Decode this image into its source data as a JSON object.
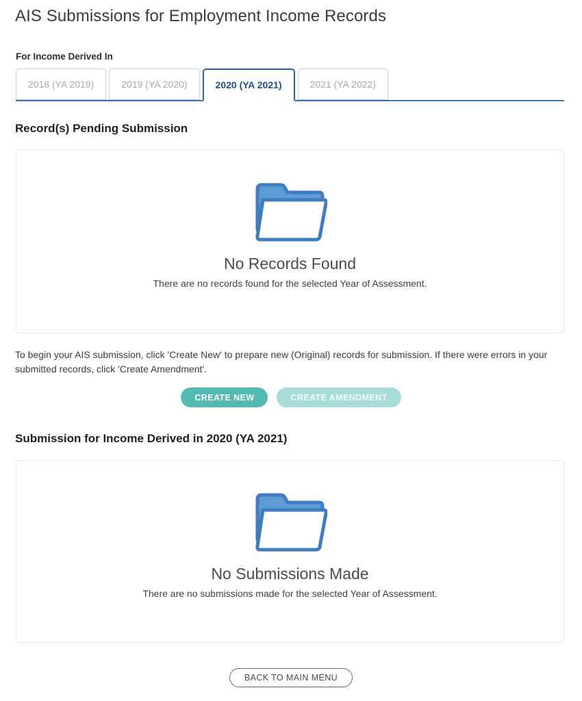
{
  "page": {
    "title": "AIS Submissions for Employment Income Records"
  },
  "tabs": {
    "label": "For Income Derived In",
    "items": [
      {
        "label": "2018 (YA 2019)",
        "active": false
      },
      {
        "label": "2019 (YA 2020)",
        "active": false
      },
      {
        "label": "2020 (YA 2021)",
        "active": true
      },
      {
        "label": "2021 (YA 2022)",
        "active": false
      }
    ],
    "active_index": 2,
    "active_color": "#2b5f9e",
    "inactive_color": "#a8a8a8",
    "underline_color": "#3573b9"
  },
  "pending_section": {
    "heading": "Record(s) Pending Submission",
    "empty_state": {
      "icon": "folder-open-icon",
      "title": "No Records Found",
      "subtitle": "There are no records found for the selected Year of Assessment."
    }
  },
  "instructions": {
    "text": "To begin your AIS submission, click 'Create New' to prepare new (Original) records for submission. If there were errors in your submitted records, click 'Create Amendment'."
  },
  "actions": {
    "create_new_label": "CREATE NEW",
    "create_amendment_label": "CREATE AMENDMENT",
    "primary_color": "#52b9b3",
    "disabled_color": "#a8dcd8"
  },
  "submission_section": {
    "heading": "Submission for Income Derived in 2020 (YA 2021)",
    "empty_state": {
      "icon": "folder-open-icon",
      "title": "No Submissions Made",
      "subtitle": "There are no submissions made for the selected Year of Assessment."
    }
  },
  "footer": {
    "back_label": "BACK TO MAIN MENU"
  },
  "folder_icon": {
    "stroke": "#3f7cc0",
    "back_fill": "#5f9bd5"
  }
}
